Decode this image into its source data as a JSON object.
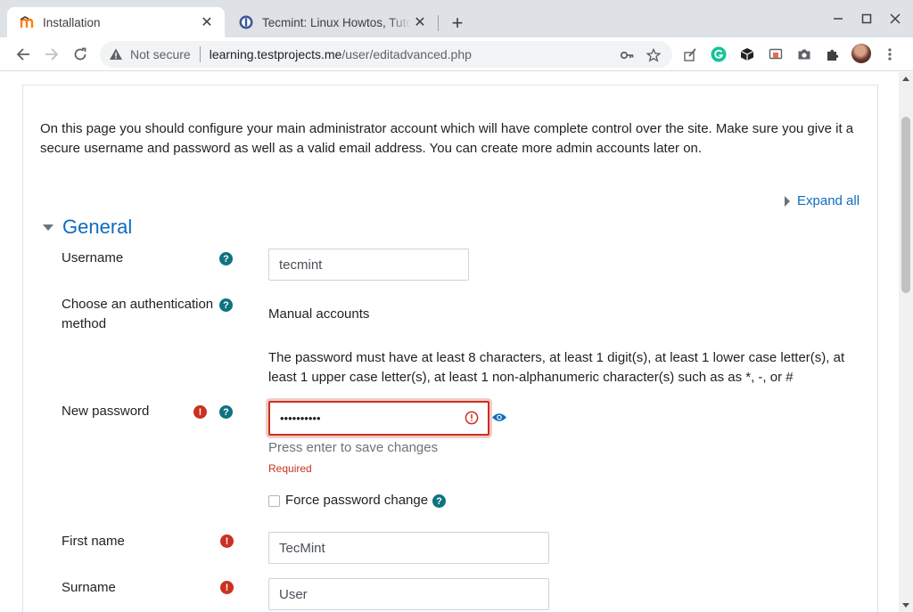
{
  "browser": {
    "tabs": [
      {
        "title": "Installation",
        "active": true
      },
      {
        "title": "Tecmint: Linux Howtos, Tutorials & Guides",
        "active": false
      }
    ],
    "security_label": "Not secure",
    "url_host": "learning.testprojects.me",
    "url_path": "/user/editadvanced.php",
    "icons": {
      "new_tab": "plus-icon",
      "minimize": "minimize-icon",
      "maximize": "maximize-icon",
      "close": "close-icon",
      "back": "back-arrow-icon",
      "forward": "forward-arrow-icon",
      "reload": "reload-icon",
      "warning": "warning-icon",
      "key": "key-icon",
      "bookmark": "star-icon"
    }
  },
  "page": {
    "intro": "On this page you should configure your main administrator account which will have complete control over the site. Make sure you give it a secure username and password as well as a valid email address. You can create more admin accounts later on.",
    "expand_all": "Expand all",
    "section_title": "General",
    "fields": {
      "username": {
        "label": "Username",
        "value": "tecmint"
      },
      "auth": {
        "label": "Choose an authentication method",
        "value": "Manual accounts"
      },
      "password_policy": "The password must have at least 8 characters, at least 1 digit(s), at least 1 lower case letter(s), at least 1 upper case letter(s), at least 1 non-alphanumeric character(s) such as as *, -, or #",
      "new_password": {
        "label": "New password",
        "value": "••••••••••",
        "hint": "Press enter to save changes",
        "error": "Required"
      },
      "force_change": {
        "label": "Force password change",
        "checked": false
      },
      "first_name": {
        "label": "First name",
        "value": "TecMint"
      },
      "surname": {
        "label": "Surname",
        "value": "User"
      }
    },
    "help_icon_char": "?",
    "required_icon_char": "!"
  },
  "colors": {
    "accent": "#0f6cbf",
    "help": "#0f7380",
    "error": "#ca3120"
  }
}
